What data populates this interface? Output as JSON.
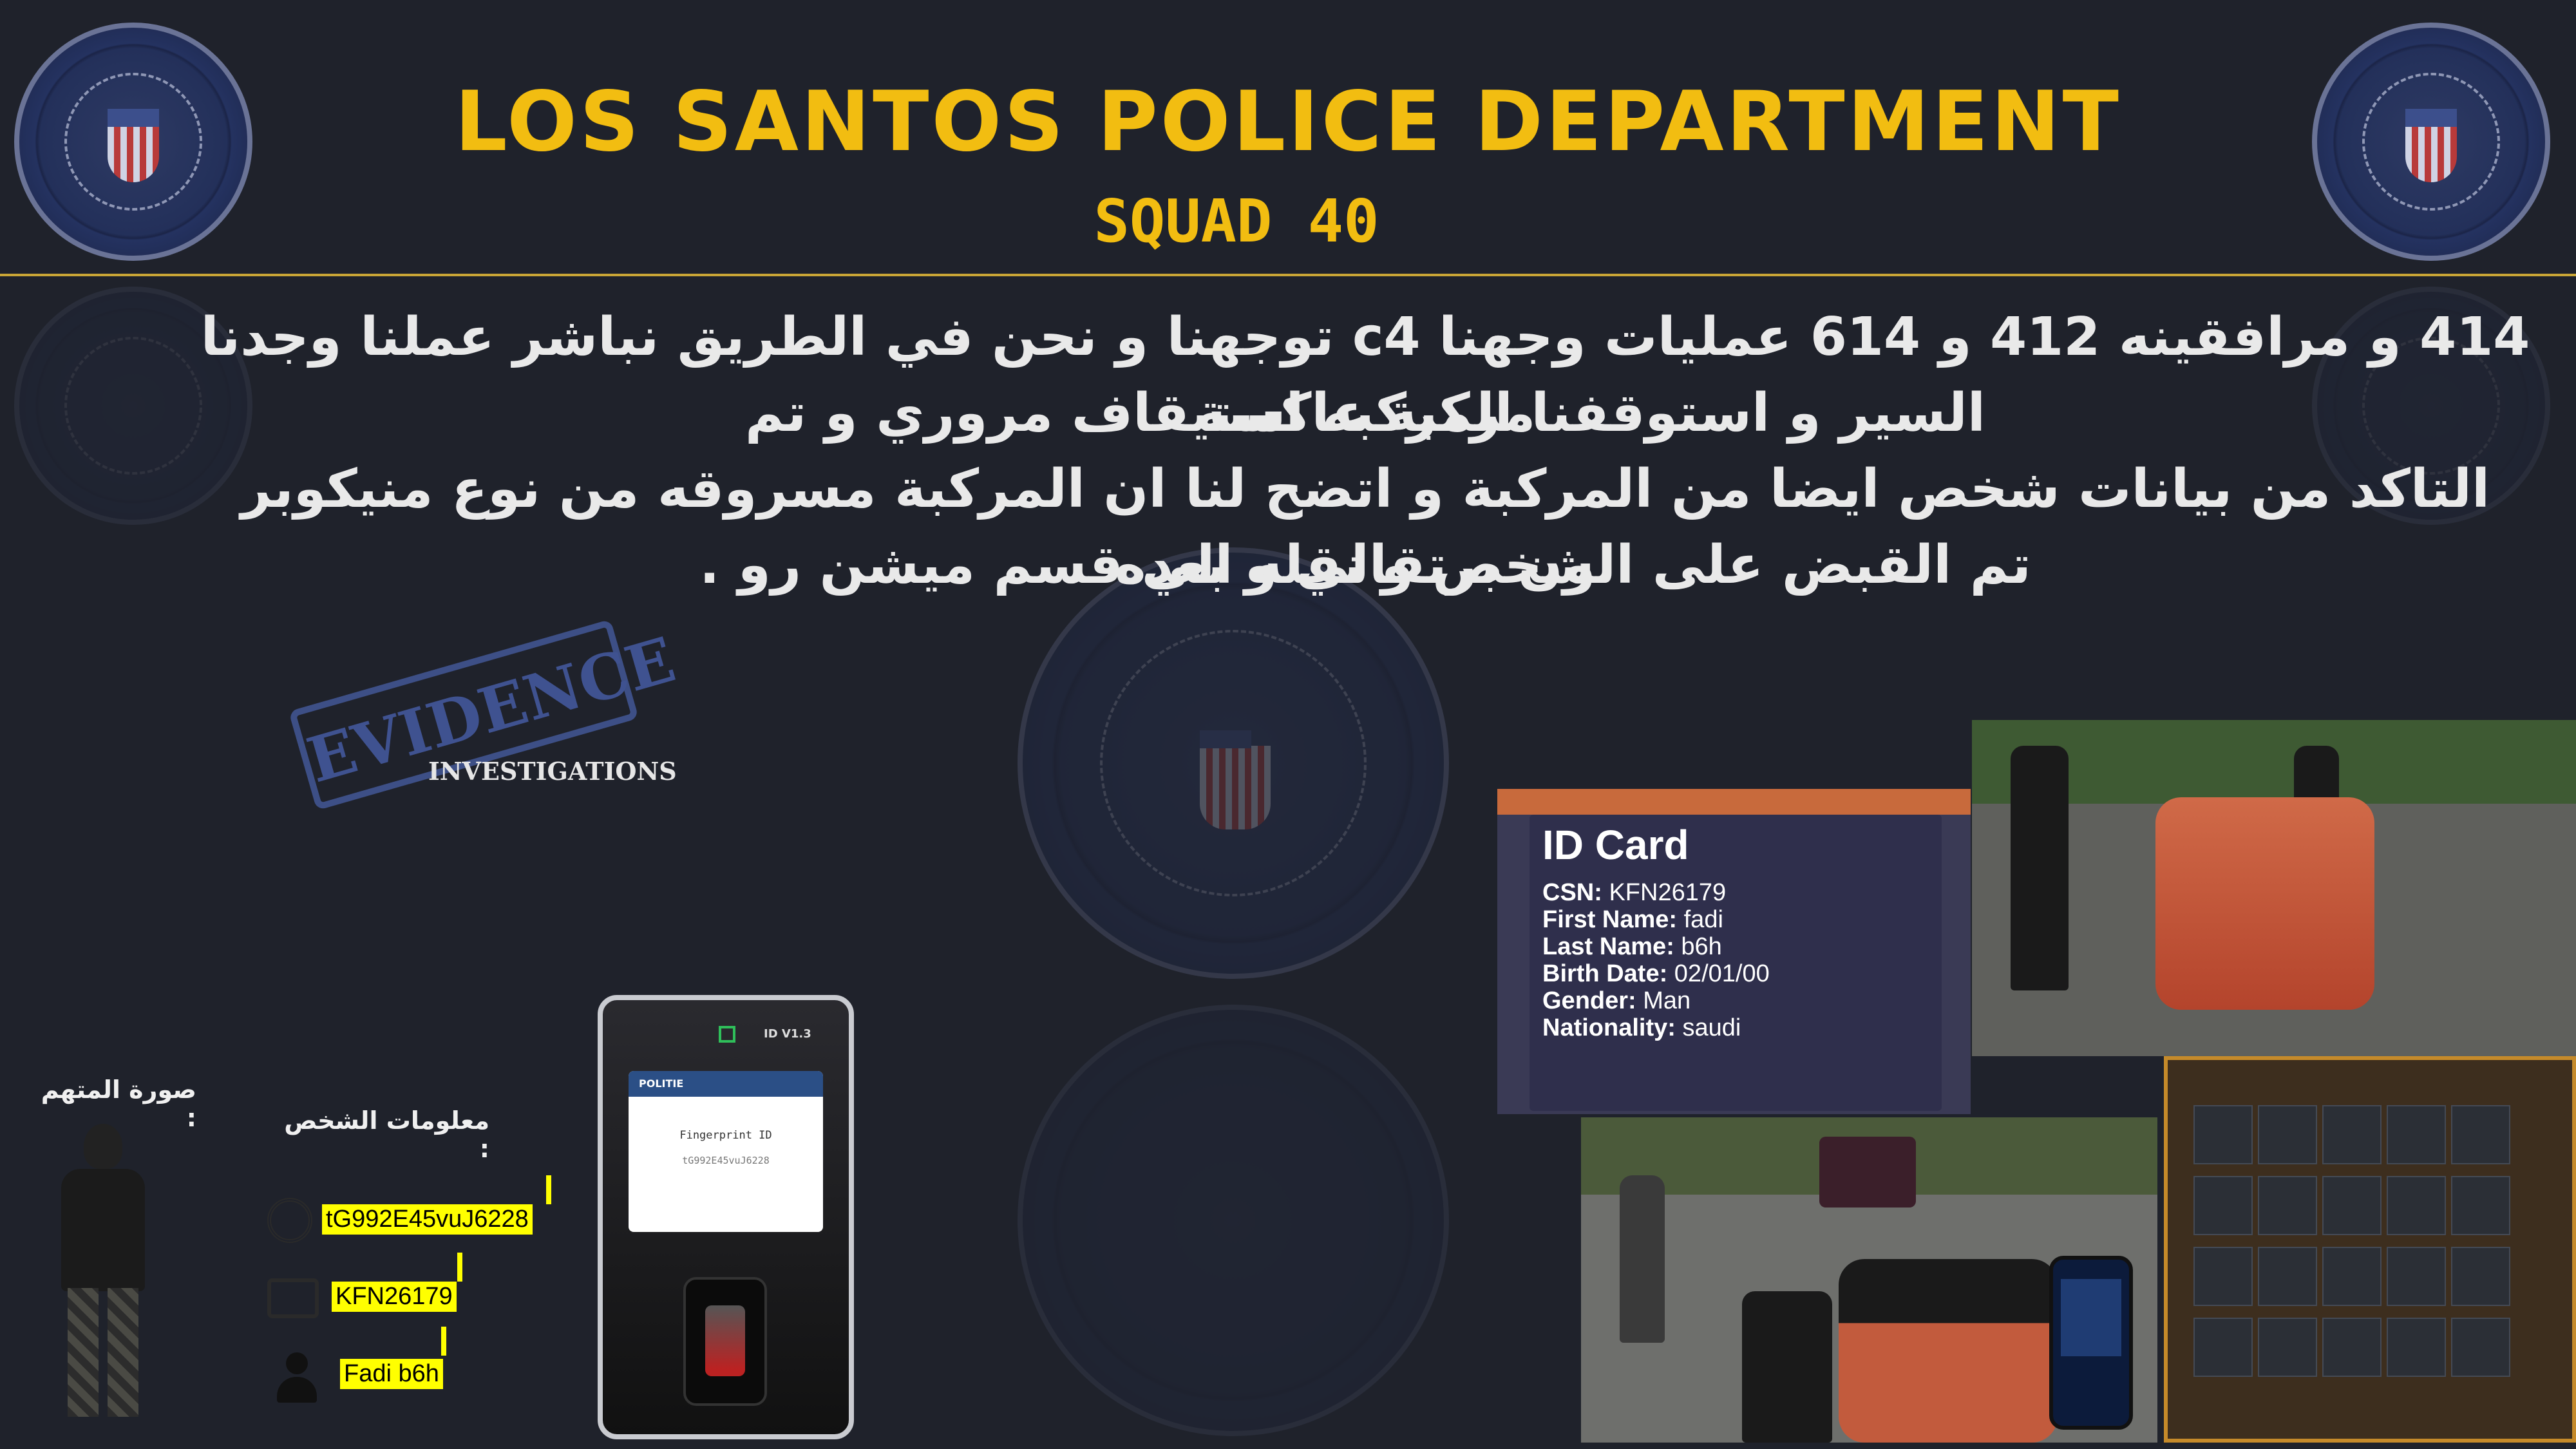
{
  "header": {
    "title": "LOS SANTOS POLICE DEPARTMENT",
    "subtitle": "SQUAD 40"
  },
  "report": {
    "line1": "414 و مرافقينه 412 و 614 عمليات وجهنا  c4 توجهنا و نحن في الطريق نباشر عملنا وجدنا مركبة عاكسة",
    "line2": "السير و استوقفنا المركبه استيقاف مروري و تم",
    "line3": "التاكد من بيانات شخص ايضا من المركبة و اتضح لنا ان المركبة مسروقه من نوع منيكوبر لون برتقالي و بعده",
    "line4": "تم القبض على الشخص و نقله الي قسم ميشن رو ."
  },
  "evidence_stamp": {
    "word": "EVIDENCE",
    "caption": "INVESTIGATIONS"
  },
  "suspect": {
    "photo_label": "صورة المتهم :",
    "info_label": "معلومات الشخص :",
    "fingerprint": "tG992E45vuJ6228",
    "csn": "KFN26179",
    "name": "Fadi b6h"
  },
  "scanner": {
    "model": "ID V1.3",
    "brand": "POLITIE",
    "screen_title": "Fingerprint ID",
    "screen_value": "tG992E45vuJ6228"
  },
  "id_card": {
    "title": "ID Card",
    "rows": [
      {
        "label": "CSN:",
        "value": "KFN26179"
      },
      {
        "label": "First Name:",
        "value": "fadi"
      },
      {
        "label": "Last Name:",
        "value": "b6h"
      },
      {
        "label": "Birth Date:",
        "value": "02/01/00"
      },
      {
        "label": "Gender:",
        "value": "Man"
      },
      {
        "label": "Nationality:",
        "value": "saudi"
      }
    ]
  },
  "colors": {
    "background": "#1f222b",
    "accent": "#f2bd11",
    "highlight": "#ffff00"
  }
}
